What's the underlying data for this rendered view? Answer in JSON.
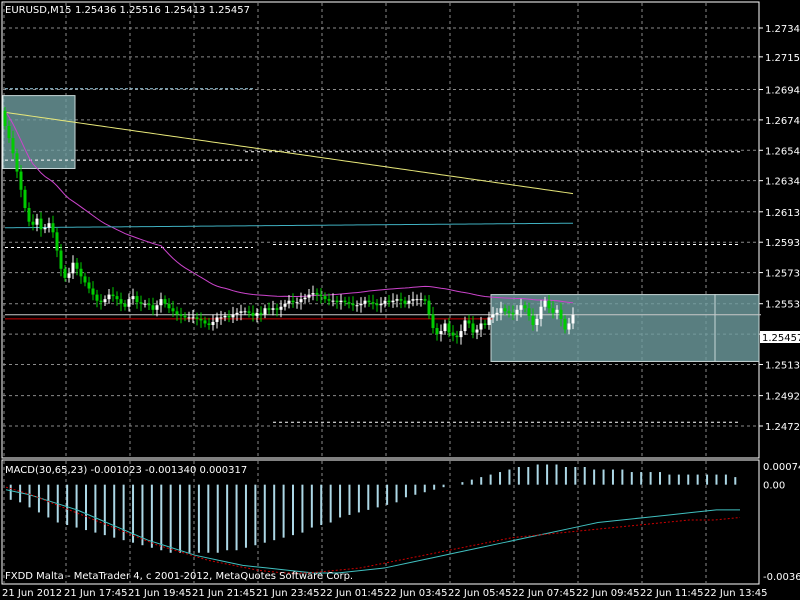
{
  "header": {
    "symbol_timeframe": "EURUSD,M15",
    "ohlc": "1.25436 1.25516 1.25413 1.25457"
  },
  "footer": {
    "copyright": "FXDD Malta - MetaTrader 4, c 2001-2012, MetaQuotes Software Corp."
  },
  "colors": {
    "background": "#000000",
    "grid": "#8a8a8a",
    "bull_candle": "#ffffff",
    "bear_candle": "#00cc00",
    "ma_yellow": "#e8e87a",
    "ma_magenta": "#cc44cc",
    "ma_cyan": "#40b0c0",
    "bid_line": "#c8c8c8",
    "red_line": "#cc0000",
    "zone_fill": "#6f9ea0",
    "macd_hist": "#add8e6",
    "macd_signal_line": "#40c0c0",
    "macd_red_line": "#cc0000"
  },
  "chart_data": [
    {
      "type": "candlestick",
      "title": "EURUSD,M15",
      "ylim": [
        1.24725,
        1.27345
      ],
      "y_ticks": [
        "1.27345",
        "1.27155",
        "1.26940",
        "1.26740",
        "1.26540",
        "1.26340",
        "1.26135",
        "1.25935",
        "1.25735",
        "1.25530",
        "1.25330",
        "1.25130",
        "1.24925",
        "1.24725"
      ],
      "current_price": "1.25457",
      "x_ticks": [
        "21 Jun 2012",
        "21 Jun 17:45",
        "21 Jun 19:45",
        "21 Jun 21:45",
        "21 Jun 23:45",
        "22 Jun 01:45",
        "22 Jun 03:45",
        "22 Jun 05:45",
        "22 Jun 07:45",
        "22 Jun 09:45",
        "22 Jun 11:45",
        "22 Jun 13:45"
      ],
      "closes": [
        1.267,
        1.2662,
        1.2652,
        1.264,
        1.2628,
        1.2616,
        1.2607,
        1.2605,
        1.2609,
        1.2602,
        1.2603,
        1.2606,
        1.26,
        1.2588,
        1.2576,
        1.257,
        1.2573,
        1.258,
        1.2576,
        1.2571,
        1.2567,
        1.2563,
        1.2559,
        1.2555,
        1.2554,
        1.2556,
        1.2559,
        1.2558,
        1.2556,
        1.2553,
        1.2551,
        1.2556,
        1.2558,
        1.2554,
        1.2553,
        1.2553,
        1.2552,
        1.2549,
        1.2552,
        1.2556,
        1.2553,
        1.255,
        1.2548,
        1.2546,
        1.2545,
        1.2544,
        1.2544,
        1.2544,
        1.2543,
        1.2542,
        1.254,
        1.2539,
        1.2541,
        1.2544,
        1.2544,
        1.2545,
        1.2544,
        1.2546,
        1.2547,
        1.2548,
        1.2548,
        1.2547,
        1.2545,
        1.2547,
        1.2546,
        1.255,
        1.2549,
        1.255,
        1.2549,
        1.2551,
        1.2553,
        1.2555,
        1.2554,
        1.2554,
        1.2556,
        1.2557,
        1.2559,
        1.256,
        1.2559,
        1.2558,
        1.2556,
        1.2555,
        1.2555,
        1.2554,
        1.2555,
        1.2554,
        1.2553,
        1.2552,
        1.2552,
        1.2553,
        1.2555,
        1.2554,
        1.2553,
        1.2552,
        1.2553,
        1.2555,
        1.2554,
        1.2555,
        1.2556,
        1.2555,
        1.2553,
        1.2555,
        1.2556,
        1.2556,
        1.2556,
        1.2555,
        1.2546,
        1.2537,
        1.2533,
        1.2535,
        1.254,
        1.2534,
        1.2532,
        1.2531,
        1.2535,
        1.2542,
        1.254,
        1.2534,
        1.2536,
        1.254,
        1.2539,
        1.2544,
        1.2546,
        1.2547,
        1.255,
        1.2548,
        1.2547,
        1.2546,
        1.2549,
        1.2552,
        1.255,
        1.2545,
        1.2539,
        1.2543,
        1.2551,
        1.2555,
        1.255,
        1.2547,
        1.2549,
        1.2543,
        1.2536,
        1.254,
        1.25457
      ],
      "zones": [
        {
          "name": "supply-zone",
          "x0": 0,
          "x1": 18,
          "y_top": 1.269,
          "y_bottom": 1.2642,
          "fill": "#6f9ea0"
        },
        {
          "name": "range-zone-1",
          "x0": 122,
          "x1": 178,
          "y_top": 1.2559,
          "y_bottom": 1.2515,
          "fill": "#6f9ea0"
        },
        {
          "name": "range-zone-2",
          "x0": 178,
          "x1": 189,
          "y_top": 1.2559,
          "y_bottom": 1.2515,
          "fill": "#6f9ea0"
        }
      ],
      "horizontal_lines": [
        {
          "name": "blue-dotted-level-1",
          "price": 1.26945,
          "x0": 0,
          "x1": 62,
          "color": "#9dcfe6",
          "dash": "3,2"
        },
        {
          "name": "white-dotted-level-1",
          "price": 1.2653,
          "x0": 60,
          "x1": 184,
          "color": "#ffffff",
          "dash": "3,3"
        },
        {
          "name": "white-dotted-level-2",
          "price": 1.26475,
          "x0": 0,
          "x1": 62,
          "color": "#ffffff",
          "dash": "3,3"
        },
        {
          "name": "white-dotted-level-3",
          "price": 1.259,
          "x0": 0,
          "x1": 62,
          "color": "#ffffff",
          "dash": "3,3"
        },
        {
          "name": "white-dotted-level-4",
          "price": 1.2592,
          "x0": 67,
          "x1": 184,
          "color": "#ffffff",
          "dash": "3,3"
        },
        {
          "name": "bid-line",
          "price": 1.25457,
          "x0": 0,
          "x1": 189,
          "color": "#c8c8c8",
          "dash": ""
        },
        {
          "name": "red-level-line",
          "price": 1.2543,
          "x0": 0,
          "x1": 122,
          "color": "#cc0000",
          "dash": ""
        },
        {
          "name": "white-dotted-level-5",
          "price": 1.2475,
          "x0": 67,
          "x1": 184,
          "color": "#ffffff",
          "dash": "3,3"
        }
      ]
    },
    {
      "type": "bar+line",
      "title": "MACD(30,65,23) -0.001023 -0.001340 0.000317",
      "ylim": [
        -0.00362,
        0.00074
      ],
      "y_ticks": [
        "0.00074",
        "0.00",
        "-0.00362"
      ],
      "histogram": [
        -0.0006,
        -0.0007,
        -0.0009,
        -0.0011,
        -0.0013,
        -0.0015,
        -0.0016,
        -0.0017,
        -0.0018,
        -0.0019,
        -0.002,
        -0.0021,
        -0.0022,
        -0.0023,
        -0.0024,
        -0.0025,
        -0.0026,
        -0.0027,
        -0.0027,
        -0.0027,
        -0.0027,
        -0.0027,
        -0.0027,
        -0.0026,
        -0.0026,
        -0.0025,
        -0.0024,
        -0.0023,
        -0.0022,
        -0.0021,
        -0.002,
        -0.0019,
        -0.0017,
        -0.0016,
        -0.0015,
        -0.0013,
        -0.0012,
        -0.0011,
        -0.001,
        -0.0009,
        -0.0008,
        -0.0007,
        -0.0005,
        -0.0004,
        -0.0003,
        -0.0002,
        -0.0001,
        0.0,
        0.0001,
        0.0002,
        0.0003,
        0.0004,
        0.0005,
        0.0006,
        0.0007,
        0.0007,
        0.0008,
        0.0008,
        0.0008,
        0.0007,
        0.0007,
        0.0007,
        0.0006,
        0.0006,
        0.0006,
        0.0006,
        0.0005,
        0.0005,
        0.0005,
        0.0005,
        0.0004,
        0.0004,
        0.0004,
        0.0004,
        0.0004,
        0.0004,
        0.0004,
        0.0003
      ],
      "signal_line": [
        -0.0002,
        -0.0004,
        -0.0007,
        -0.001,
        -0.0014,
        -0.0018,
        -0.0022,
        -0.0025,
        -0.0028,
        -0.003,
        -0.0032,
        -0.0033,
        -0.0034,
        -0.0035,
        -0.0035,
        -0.0034,
        -0.0033,
        -0.0031,
        -0.0029,
        -0.0027,
        -0.0025,
        -0.0023,
        -0.0021,
        -0.0019,
        -0.0017,
        -0.0015,
        -0.0014,
        -0.0013,
        -0.0012,
        -0.0011,
        -0.001,
        -0.001
      ],
      "red_line": [
        -0.0001,
        -0.0004,
        -0.0008,
        -0.0012,
        -0.0016,
        -0.002,
        -0.0024,
        -0.0027,
        -0.003,
        -0.0032,
        -0.0034,
        -0.0035,
        -0.0035,
        -0.0034,
        -0.0033,
        -0.0031,
        -0.0029,
        -0.0027,
        -0.0025,
        -0.0023,
        -0.0021,
        -0.002,
        -0.0019,
        -0.0018,
        -0.0017,
        -0.0016,
        -0.0015,
        -0.0014,
        -0.0014,
        -0.0013
      ]
    }
  ]
}
